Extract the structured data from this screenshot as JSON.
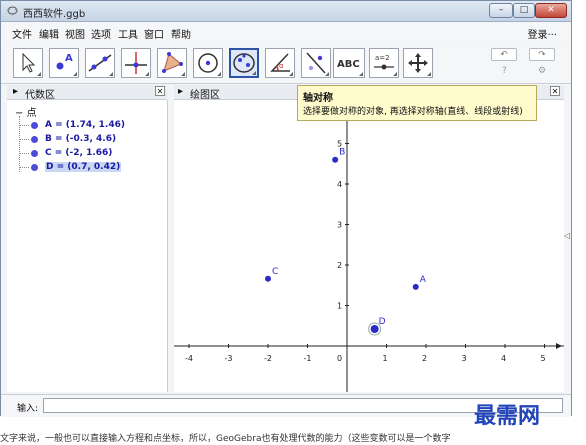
{
  "window": {
    "title": "西西软件.ggb",
    "controls": {
      "minimize": "–",
      "maximize": "□",
      "close": "✕"
    }
  },
  "menu": {
    "items": [
      "文件",
      "编辑",
      "视图",
      "选项",
      "工具",
      "窗口",
      "帮助"
    ],
    "login": "登录···"
  },
  "toolbar": {
    "tools": [
      {
        "name": "move-tool",
        "icon": "arrow-icon"
      },
      {
        "name": "point-tool",
        "icon": "point-icon",
        "glyph": "A"
      },
      {
        "name": "line-tool",
        "icon": "line-icon"
      },
      {
        "name": "perpendicular-tool",
        "icon": "perpendicular-icon"
      },
      {
        "name": "polygon-tool",
        "icon": "polygon-icon"
      },
      {
        "name": "circle-tool",
        "icon": "circle-icon"
      },
      {
        "name": "conic-tool",
        "icon": "ellipse-icon"
      },
      {
        "name": "angle-tool",
        "icon": "angle-icon"
      },
      {
        "name": "reflect-tool",
        "icon": "reflect-icon"
      },
      {
        "name": "text-tool",
        "icon": "text-icon",
        "glyph": "ABC"
      },
      {
        "name": "slider-tool",
        "icon": "slider-icon",
        "glyph": "a=2"
      },
      {
        "name": "move-view-tool",
        "icon": "move-view-icon"
      }
    ],
    "undo": "↶",
    "redo": "↷",
    "help": "?",
    "settings": "⚙"
  },
  "algebra": {
    "title": "代数区",
    "folder": "点",
    "rows": [
      {
        "label": "A = (1.74, 1.46)",
        "selected": false
      },
      {
        "label": "B = (-0.3, 4.6)",
        "selected": false
      },
      {
        "label": "C = (-2, 1.66)",
        "selected": false
      },
      {
        "label": "D = (0.7, 0.42)",
        "selected": true
      }
    ]
  },
  "graphics": {
    "title": "绘图区",
    "x_ticks": [
      "-4",
      "-3",
      "-2",
      "-1",
      "0",
      "1",
      "2",
      "3",
      "4",
      "5"
    ],
    "y_ticks": [
      "1",
      "2",
      "3",
      "4",
      "5"
    ],
    "points": [
      {
        "name": "A",
        "x": 1.74,
        "y": 1.46
      },
      {
        "name": "B",
        "x": -0.3,
        "y": 4.6
      },
      {
        "name": "C",
        "x": -2,
        "y": 1.66
      },
      {
        "name": "D",
        "x": 0.7,
        "y": 0.42
      }
    ],
    "point_color": "#2b2bc8"
  },
  "tooltip": {
    "title": "轴对称",
    "text": "选择要做对称的对象, 再选择对称轴(直线、线段或射线)"
  },
  "input": {
    "label": "输入:"
  },
  "brand": "最需网",
  "caption": "文字来说，一般也可以直接输入方程和点坐标，所以，GeoGebra也有处理代数的能力（这些变数可以是一个数字"
}
